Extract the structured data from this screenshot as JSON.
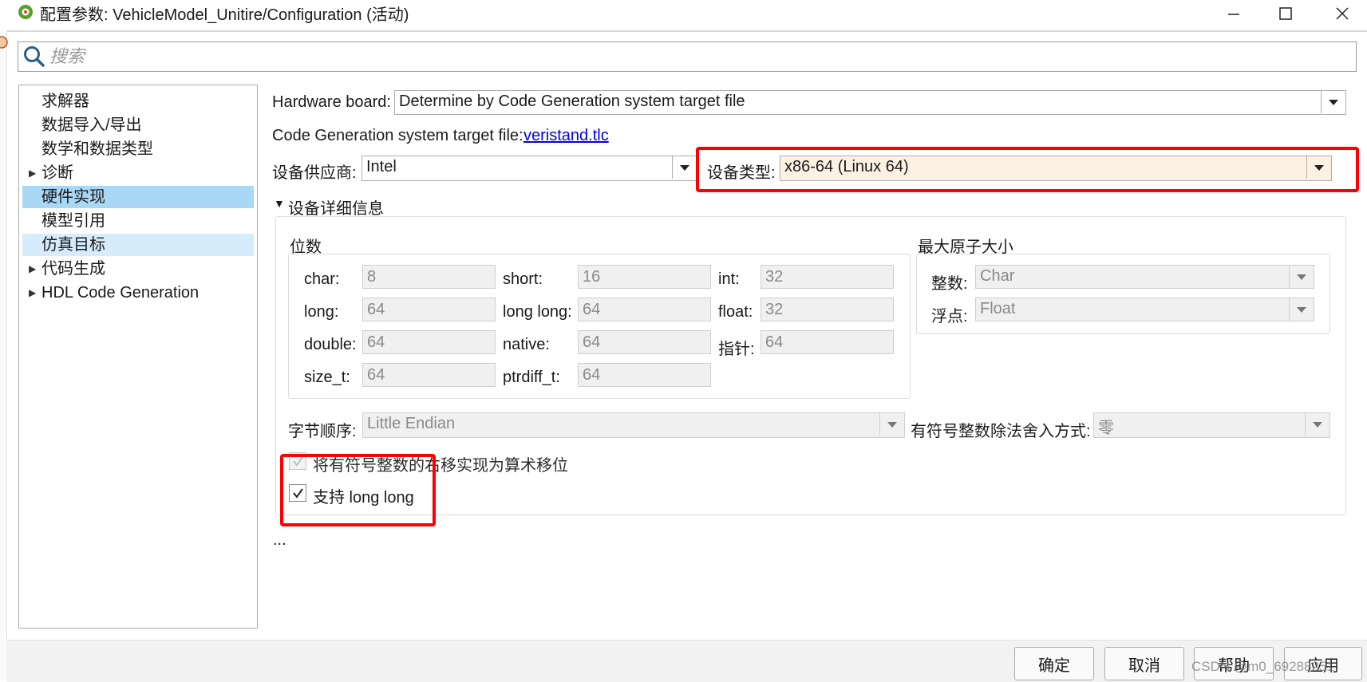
{
  "window": {
    "title": "配置参数: VehicleModel_Unitire/Configuration (活动)",
    "icon": "gear-icon"
  },
  "search": {
    "placeholder": "搜索",
    "value": ""
  },
  "tree": {
    "items": [
      {
        "label": "求解器"
      },
      {
        "label": "数据导入/导出"
      },
      {
        "label": "数学和数据类型"
      },
      {
        "label": "诊断",
        "expandable": true
      },
      {
        "label": "硬件实现",
        "selected": true
      },
      {
        "label": "模型引用"
      },
      {
        "label": "仿真目标"
      },
      {
        "label": "代码生成",
        "expandable": true
      },
      {
        "label": "HDL Code Generation",
        "expandable": true
      }
    ]
  },
  "hardware": {
    "board_label": "Hardware board:",
    "board_value": "Determine by Code Generation system target file",
    "target_file_label": "Code Generation system target file:",
    "target_file_link": "veristand.tlc",
    "vendor_label": "设备供应商:",
    "vendor_value": "Intel",
    "type_label": "设备类型:",
    "type_value": "x86-64 (Linux 64)",
    "details_label": "设备详细信息"
  },
  "bits": {
    "title": "位数",
    "char_label": "char:",
    "char_value": "8",
    "short_label": "short:",
    "short_value": "16",
    "int_label": "int:",
    "int_value": "32",
    "long_label": "long:",
    "long_value": "64",
    "longlong_label": "long long:",
    "longlong_value": "64",
    "float_label": "float:",
    "float_value": "32",
    "double_label": "double:",
    "double_value": "64",
    "native_label": "native:",
    "native_value": "64",
    "pointer_label": "指针:",
    "pointer_value": "64",
    "sizet_label": "size_t:",
    "sizet_value": "64",
    "ptrdiff_label": "ptrdiff_t:",
    "ptrdiff_value": "64"
  },
  "atomic": {
    "title": "最大原子大小",
    "integer_label": "整数:",
    "integer_value": "Char",
    "float_label": "浮点:",
    "float_value": "Float"
  },
  "byte_order": {
    "label": "字节顺序:",
    "value": "Little Endian"
  },
  "rounding": {
    "label": "有符号整数除法舍入方式:",
    "value": "零"
  },
  "checkboxes": {
    "shift_label": "将有符号整数的右移实现为算术移位",
    "shift_checked": true,
    "longlong_label": "支持 long long",
    "longlong_checked": true
  },
  "ellipsis": "...",
  "footer": {
    "ok": "确定",
    "cancel": "取消",
    "help": "帮助",
    "apply": "应用",
    "watermark": "CSDN @m0_69288251"
  },
  "colors": {
    "selected_bg": "#a9d8f6",
    "hover_bg": "#d6ecfa",
    "highlight_border": "#ff0000",
    "device_type_bg": "#fdf1e4",
    "link": "#0000ee"
  }
}
